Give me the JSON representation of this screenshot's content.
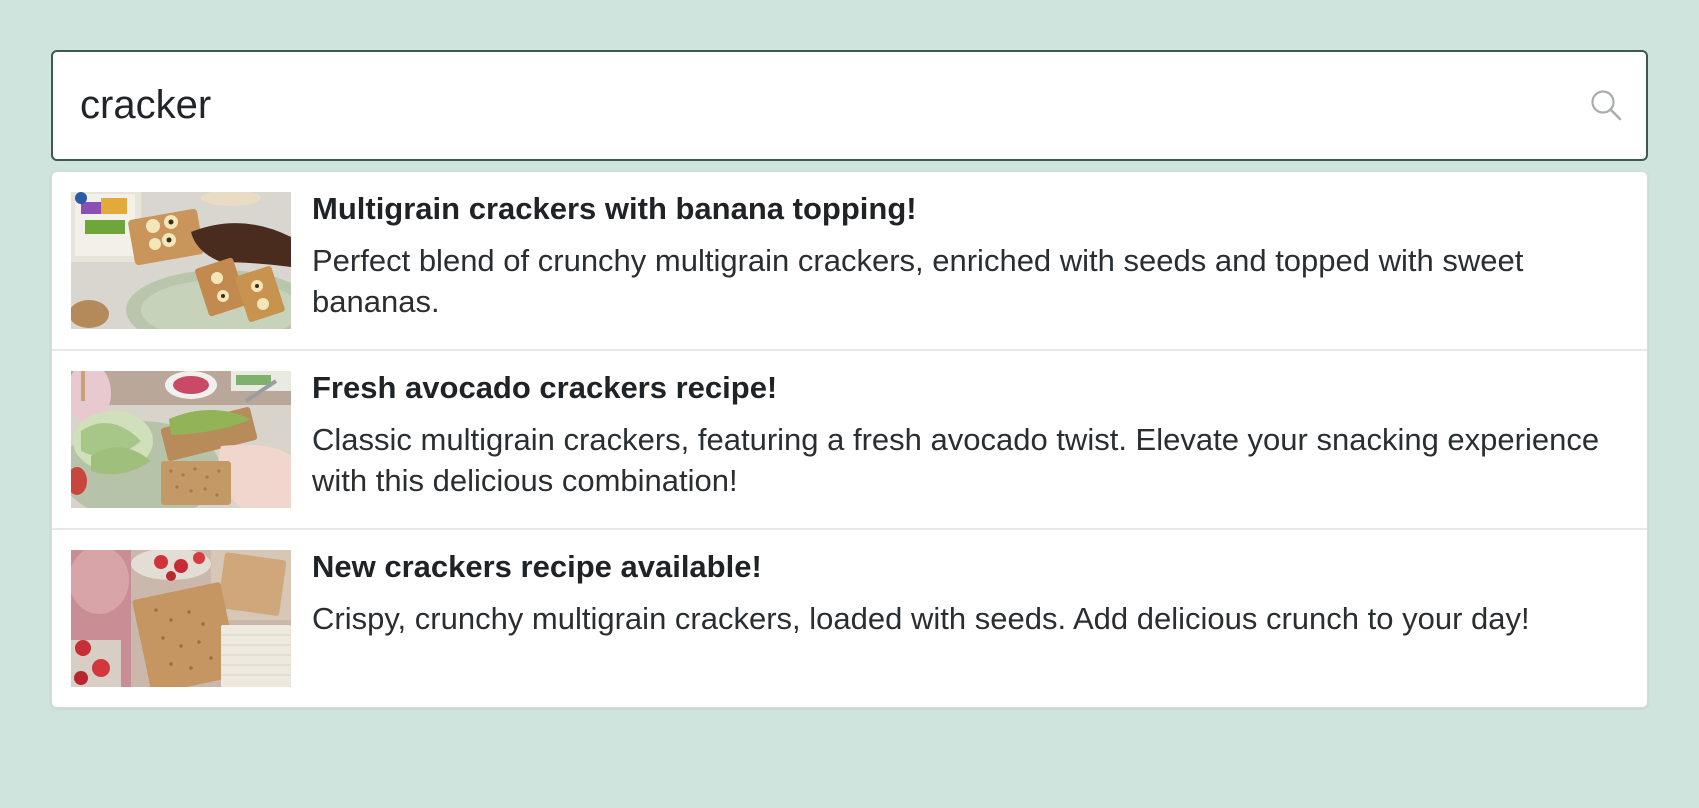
{
  "search": {
    "value": "cracker",
    "icon": "search-icon"
  },
  "results": [
    {
      "title": "Multigrain crackers with banana topping!",
      "description": "Perfect blend of crunchy multigrain crackers, enriched with seeds and topped with sweet bananas.",
      "image": "crackers-banana-thumbnail"
    },
    {
      "title": "Fresh avocado crackers recipe!",
      "description": "Classic multigrain crackers, featuring a fresh avocado twist. Elevate your snacking experience with this delicious combination!",
      "image": "crackers-avocado-thumbnail"
    },
    {
      "title": "New crackers recipe available!",
      "description": "Crispy, crunchy multigrain crackers, loaded with seeds. Add delicious crunch to your day!",
      "image": "crackers-strawberry-thumbnail"
    }
  ],
  "colors": {
    "background": "#cfe4dd",
    "input_border": "#3e5a50",
    "text": "#212529"
  }
}
